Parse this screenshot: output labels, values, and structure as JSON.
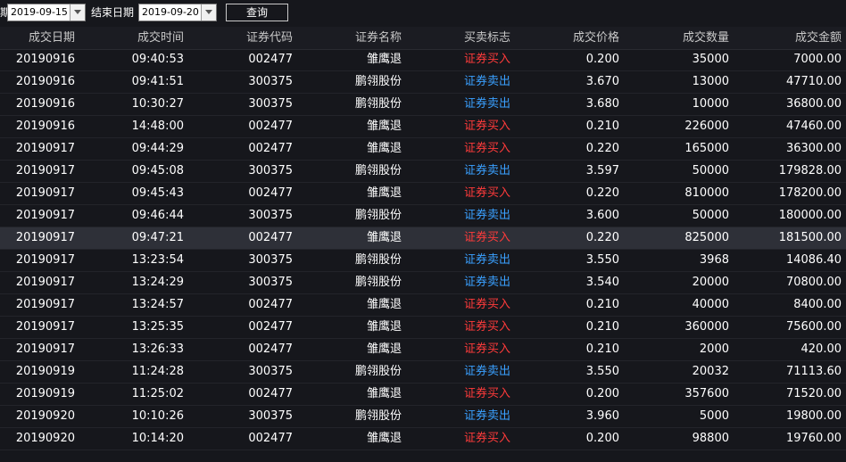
{
  "filter": {
    "start_label_partial": "期",
    "start_date": "2019-09-15",
    "end_label": "结束日期",
    "end_date": "2019-09-20",
    "query_button": "查询"
  },
  "table": {
    "columns": [
      "成交日期",
      "成交时间",
      "证券代码",
      "证券名称",
      "买卖标志",
      "成交价格",
      "成交数量",
      "成交金额"
    ],
    "rows": [
      {
        "date": "20190916",
        "time": "09:40:53",
        "code": "002477",
        "name": "雏鹰退",
        "side": "证券买入",
        "side_type": "buy",
        "price": "0.200",
        "qty": "35000",
        "amount": "7000.00"
      },
      {
        "date": "20190916",
        "time": "09:41:51",
        "code": "300375",
        "name": "鹏翎股份",
        "side": "证券卖出",
        "side_type": "sell",
        "price": "3.670",
        "qty": "13000",
        "amount": "47710.00"
      },
      {
        "date": "20190916",
        "time": "10:30:27",
        "code": "300375",
        "name": "鹏翎股份",
        "side": "证券卖出",
        "side_type": "sell",
        "price": "3.680",
        "qty": "10000",
        "amount": "36800.00"
      },
      {
        "date": "20190916",
        "time": "14:48:00",
        "code": "002477",
        "name": "雏鹰退",
        "side": "证券买入",
        "side_type": "buy",
        "price": "0.210",
        "qty": "226000",
        "amount": "47460.00"
      },
      {
        "date": "20190917",
        "time": "09:44:29",
        "code": "002477",
        "name": "雏鹰退",
        "side": "证券买入",
        "side_type": "buy",
        "price": "0.220",
        "qty": "165000",
        "amount": "36300.00"
      },
      {
        "date": "20190917",
        "time": "09:45:08",
        "code": "300375",
        "name": "鹏翎股份",
        "side": "证券卖出",
        "side_type": "sell",
        "price": "3.597",
        "qty": "50000",
        "amount": "179828.00"
      },
      {
        "date": "20190917",
        "time": "09:45:43",
        "code": "002477",
        "name": "雏鹰退",
        "side": "证券买入",
        "side_type": "buy",
        "price": "0.220",
        "qty": "810000",
        "amount": "178200.00"
      },
      {
        "date": "20190917",
        "time": "09:46:44",
        "code": "300375",
        "name": "鹏翎股份",
        "side": "证券卖出",
        "side_type": "sell",
        "price": "3.600",
        "qty": "50000",
        "amount": "180000.00"
      },
      {
        "date": "20190917",
        "time": "09:47:21",
        "code": "002477",
        "name": "雏鹰退",
        "side": "证券买入",
        "side_type": "buy",
        "price": "0.220",
        "qty": "825000",
        "amount": "181500.00",
        "selected": true
      },
      {
        "date": "20190917",
        "time": "13:23:54",
        "code": "300375",
        "name": "鹏翎股份",
        "side": "证券卖出",
        "side_type": "sell",
        "price": "3.550",
        "qty": "3968",
        "amount": "14086.40"
      },
      {
        "date": "20190917",
        "time": "13:24:29",
        "code": "300375",
        "name": "鹏翎股份",
        "side": "证券卖出",
        "side_type": "sell",
        "price": "3.540",
        "qty": "20000",
        "amount": "70800.00"
      },
      {
        "date": "20190917",
        "time": "13:24:57",
        "code": "002477",
        "name": "雏鹰退",
        "side": "证券买入",
        "side_type": "buy",
        "price": "0.210",
        "qty": "40000",
        "amount": "8400.00"
      },
      {
        "date": "20190917",
        "time": "13:25:35",
        "code": "002477",
        "name": "雏鹰退",
        "side": "证券买入",
        "side_type": "buy",
        "price": "0.210",
        "qty": "360000",
        "amount": "75600.00"
      },
      {
        "date": "20190917",
        "time": "13:26:33",
        "code": "002477",
        "name": "雏鹰退",
        "side": "证券买入",
        "side_type": "buy",
        "price": "0.210",
        "qty": "2000",
        "amount": "420.00"
      },
      {
        "date": "20190919",
        "time": "11:24:28",
        "code": "300375",
        "name": "鹏翎股份",
        "side": "证券卖出",
        "side_type": "sell",
        "price": "3.550",
        "qty": "20032",
        "amount": "71113.60"
      },
      {
        "date": "20190919",
        "time": "11:25:02",
        "code": "002477",
        "name": "雏鹰退",
        "side": "证券买入",
        "side_type": "buy",
        "price": "0.200",
        "qty": "357600",
        "amount": "71520.00"
      },
      {
        "date": "20190920",
        "time": "10:10:26",
        "code": "300375",
        "name": "鹏翎股份",
        "side": "证券卖出",
        "side_type": "sell",
        "price": "3.960",
        "qty": "5000",
        "amount": "19800.00"
      },
      {
        "date": "20190920",
        "time": "10:14:20",
        "code": "002477",
        "name": "雏鹰退",
        "side": "证券买入",
        "side_type": "buy",
        "price": "0.200",
        "qty": "98800",
        "amount": "19760.00"
      }
    ]
  },
  "colors": {
    "background": "#16171c",
    "buy": "#ff3b3b",
    "sell": "#3aa0ff",
    "selected_row": "#2e3038"
  },
  "icons": {
    "dropdown": "chevron-down-icon"
  }
}
